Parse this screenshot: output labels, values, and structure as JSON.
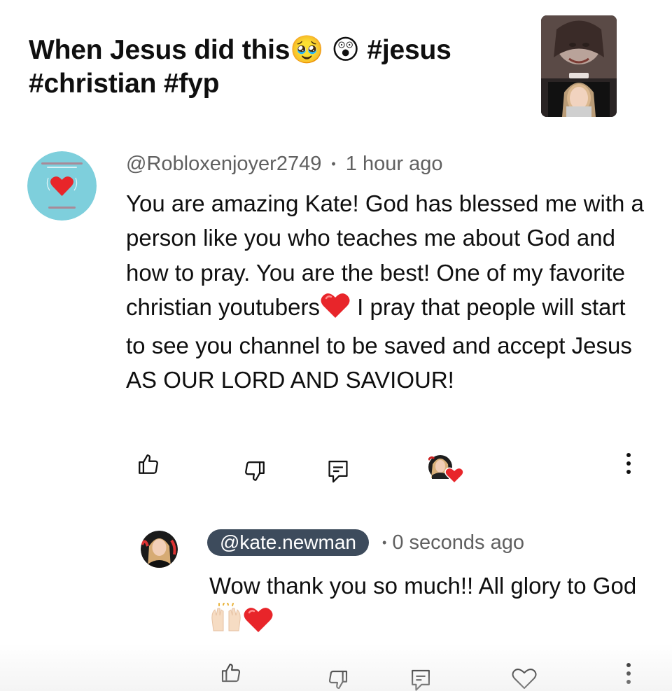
{
  "video": {
    "title": "When Jesus did this🥹 😲 #jesus #christian #fyp",
    "thumbnail_icon": "video-thumbnail"
  },
  "comment": {
    "author": "@Robloxenjoyer2749",
    "separator": "•",
    "time": "1 hour ago",
    "text_parts": [
      "You are amazing Kate! God has blessed me with a person like you who teaches me about God and how to pray. You are the best! One of my favorite christian youtubers",
      " I pray that people will start to see you channel to be saved and accept Jesus AS OUR LORD AND SAVIOUR!"
    ],
    "actions": {
      "like_icon": "thumbs-up-icon",
      "dislike_icon": "thumbs-down-icon",
      "reply_icon": "reply-icon",
      "creator_heart": "creator-heart-badge",
      "more_icon": "more-vertical-icon"
    }
  },
  "reply": {
    "author": "@kate.newman",
    "separator": "•",
    "time": "0 seconds ago",
    "text_parts": [
      "Wow thank you so much!! All glory to God"
    ],
    "actions": {
      "like_icon": "thumbs-up-icon",
      "dislike_icon": "thumbs-down-icon",
      "reply_icon": "reply-icon",
      "heart_icon": "heart-outline-icon",
      "more_icon": "more-vertical-icon"
    }
  },
  "colors": {
    "text": "#0f0f0f",
    "meta": "#606060",
    "handle_pill": "#3d4b5c",
    "heart": "#e8252a",
    "avatar_teal": "#7ecfdc"
  }
}
